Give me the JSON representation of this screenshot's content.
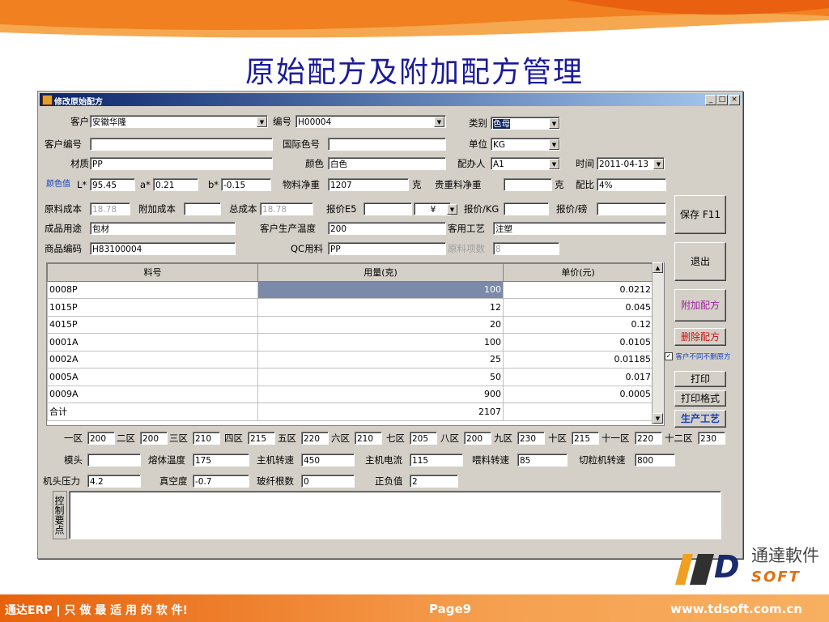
{
  "slide": {
    "title": "原始配方及附加配方管理",
    "footer_left": "通达ERP | 只 做 最 适 用 的 软 件!",
    "footer_center": "Page9",
    "footer_right": "www.tdsoft.com.cn",
    "logo_cn": "通達軟件",
    "logo_en": "SOFT",
    "logo_mark": "D"
  },
  "window": {
    "title": "修改原始配方",
    "minimize": "_",
    "maximize": "□",
    "close": "×"
  },
  "form": {
    "customer_label": "客户",
    "customer_value": "安徽华隆",
    "code_label": "编号",
    "code_value": "H00004",
    "category_label": "类别",
    "category_value": "色母",
    "customer_no_label": "客户编号",
    "customer_no_value": "",
    "intl_color_label": "国际色号",
    "intl_color_value": "",
    "unit_label": "单位",
    "unit_value": "KG",
    "material_label": "材质",
    "material_value": "PP",
    "color_label": "颜色",
    "color_value": "白色",
    "formulator_label": "配办人",
    "formulator_value": "A1",
    "time_label": "时间",
    "time_value": "2011-04-13",
    "color_val_label": "颜色值",
    "l_label": "L*",
    "l_value": "95.45",
    "a_label": "a*",
    "a_value": "0.21",
    "b_label": "b*",
    "b_value": "-0.15",
    "net_weight_label": "物料净重",
    "net_weight_value": "1207",
    "net_weight_unit": "克",
    "precious_label": "贵重料净重",
    "precious_value": "",
    "precious_unit": "克",
    "ratio_label": "配比",
    "ratio_value": "4%",
    "raw_cost_label": "原料成本",
    "raw_cost_value": "18.78",
    "extra_cost_label": "附加成本",
    "extra_cost_value": "",
    "total_cost_label": "总成本",
    "total_cost_value": "18.78",
    "quote_label": "报价E5",
    "quote_value": "",
    "currency_value": "¥",
    "quote_kg_label": "报价/KG",
    "quote_kg_value": "",
    "quote_lb_label": "报价/磅",
    "quote_lb_value": "",
    "usage_label": "成品用途",
    "usage_value": "包材",
    "cust_temp_label": "客户生产温度",
    "cust_temp_value": "200",
    "cust_process_label": "客用工艺",
    "cust_process_value": "注塑",
    "product_code_label": "商品编码",
    "product_code_value": "H83100004",
    "qc_label": "QC用料",
    "qc_value": "PP",
    "raw_items_label": "原料项数",
    "raw_items_value": "8"
  },
  "buttons": {
    "save": "保存 F11",
    "exit": "退出",
    "add_formula": "附加配方",
    "delete_formula": "删除配方",
    "keep_checkbox": "客户不同不删原方",
    "print": "打印",
    "print_format": "打印格式",
    "process": "生产工艺"
  },
  "table": {
    "headers": [
      "料号",
      "用量(克)",
      "单价(元)"
    ],
    "rows": [
      [
        "0008P",
        "100",
        "0.0212"
      ],
      [
        "1015P",
        "12",
        "0.045"
      ],
      [
        "4015P",
        "20",
        "0.12"
      ],
      [
        "0001A",
        "100",
        "0.0105"
      ],
      [
        "0002A",
        "25",
        "0.01185"
      ],
      [
        "0005A",
        "50",
        "0.017"
      ],
      [
        "0009A",
        "900",
        "0.0005"
      ]
    ],
    "total_label": "合计",
    "total_value": "2107"
  },
  "zones": [
    {
      "label": "一区",
      "value": "200"
    },
    {
      "label": "二区",
      "value": "200"
    },
    {
      "label": "三区",
      "value": "210"
    },
    {
      "label": "四区",
      "value": "215"
    },
    {
      "label": "五区",
      "value": "220"
    },
    {
      "label": "六区",
      "value": "210"
    },
    {
      "label": "七区",
      "value": "205"
    },
    {
      "label": "八区",
      "value": "200"
    },
    {
      "label": "九区",
      "value": "230"
    },
    {
      "label": "十区",
      "value": "215"
    },
    {
      "label": "十一区",
      "value": "220"
    },
    {
      "label": "十二区",
      "value": "230"
    }
  ],
  "process": {
    "head_label": "模头",
    "head_value": "",
    "melt_temp_label": "熔体温度",
    "melt_temp_value": "175",
    "rpm_label": "主机转速",
    "rpm_value": "450",
    "current_label": "主机电流",
    "current_value": "115",
    "feed_label": "喂料转速",
    "feed_value": "85",
    "cutter_label": "切粒机转速",
    "cutter_value": "800",
    "pressure_label": "机头压力",
    "pressure_value": "4.2",
    "vacuum_label": "真空度",
    "vacuum_value": "-0.7",
    "fiber_label": "玻纤根数",
    "fiber_value": "0",
    "tolerance_label": "正负值",
    "tolerance_value": "2",
    "control_label": "控制要点"
  }
}
